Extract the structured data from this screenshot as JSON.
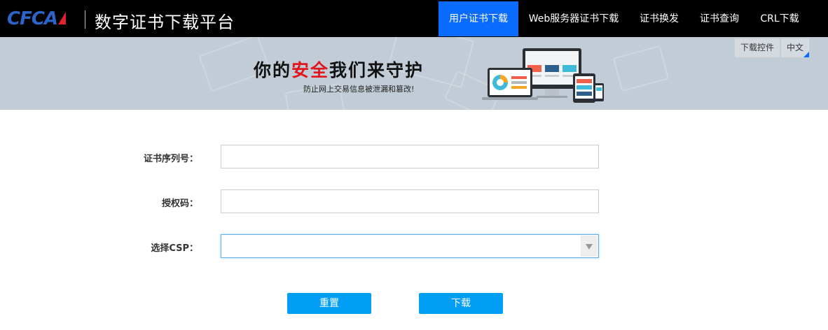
{
  "header": {
    "logo_text": "CFCA",
    "site_title": "数字证书下载平台",
    "nav": [
      {
        "label": "用户证书下载",
        "active": true
      },
      {
        "label": "Web服务器证书下载",
        "active": false
      },
      {
        "label": "证书换发",
        "active": false
      },
      {
        "label": "证书查询",
        "active": false
      },
      {
        "label": "CRL下载",
        "active": false
      }
    ]
  },
  "banner": {
    "slogan_prefix": "你的",
    "slogan_highlight": "安全",
    "slogan_suffix": "我们来守护",
    "subtitle": "防止网上交易信息被泄漏和篡改!",
    "tools": {
      "download_control": "下载控件",
      "language": "中文"
    }
  },
  "form": {
    "serial_label": "证书序列号：",
    "serial_value": "",
    "auth_label": "授权码：",
    "auth_value": "",
    "csp_label": "选择CSP：",
    "csp_selected": ""
  },
  "buttons": {
    "reset": "重置",
    "download": "下载"
  },
  "colors": {
    "accent": "#0a6cff",
    "button": "#009ff5",
    "banner_bg": "#c1ccd6",
    "slogan_red": "#e0161c"
  }
}
